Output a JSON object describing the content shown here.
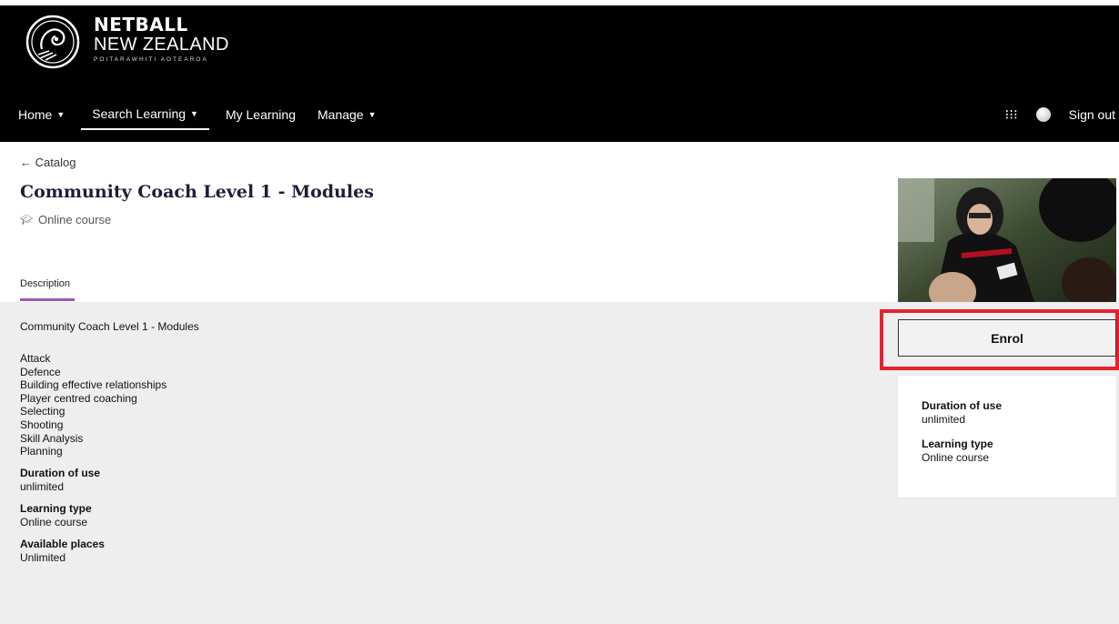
{
  "brand": {
    "line1": "NETBALL",
    "line2": "NEW ZEALAND",
    "line3": "POITARAWHITI AOTEAROA"
  },
  "nav": {
    "home": "Home",
    "search_learning": "Search Learning",
    "my_learning": "My Learning",
    "manage": "Manage",
    "sign_out": "Sign out"
  },
  "course": {
    "back_link": "← Catalog",
    "title": "Community Coach Level 1 - Modules",
    "type": "Online course",
    "tab_description": "Description",
    "description_heading": "Community Coach Level 1 - Modules",
    "modules": [
      "Attack",
      "Defence",
      "Building effective relationships",
      "Player centred coaching",
      "Selecting",
      "Shooting",
      "Skill Analysis",
      "Planning"
    ],
    "duration_label": "Duration of use",
    "duration_value": "unlimited",
    "learning_type_label": "Learning type",
    "learning_type_value": "Online course",
    "places_label": "Available places",
    "places_value": "Unlimited"
  },
  "sidebar": {
    "enrol": "Enrol",
    "duration_label": "Duration of use",
    "duration_value": "unlimited",
    "learning_type_label": "Learning type",
    "learning_type_value": "Online course"
  },
  "colors": {
    "header_bg": "#000000",
    "tab_accent": "#9b59b6",
    "highlight_border": "#e6202e",
    "panel_bg": "#eeeeee"
  }
}
